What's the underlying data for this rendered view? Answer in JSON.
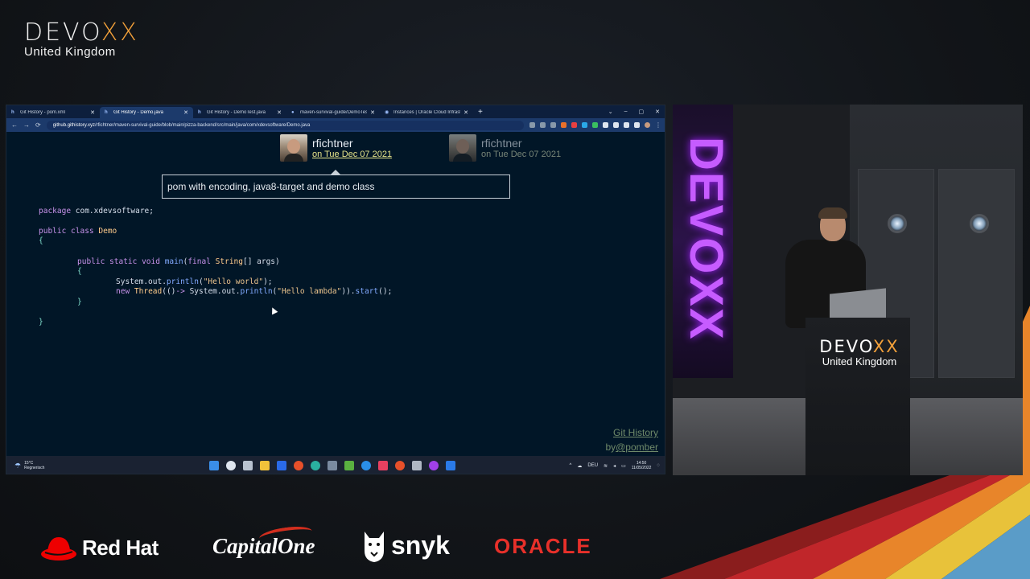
{
  "event_logo": {
    "word_prefix": "DEVO",
    "word_xx": "XX",
    "subtitle": "United Kingdom"
  },
  "browser": {
    "tabs": [
      {
        "favicon": "h",
        "title": "Git History - pom.xml",
        "active": false
      },
      {
        "favicon": "h",
        "title": "Git History - Demo.java",
        "active": true
      },
      {
        "favicon": "h",
        "title": "Git History - DemoTest.java",
        "active": false
      },
      {
        "favicon": "●",
        "title": "maven-survival-guide/DemoTes",
        "active": false
      },
      {
        "favicon": "◉",
        "title": "Instances | Oracle Cloud Infrastr",
        "active": false
      }
    ],
    "new_tab": "+",
    "window_controls": {
      "dropdown": "⌄",
      "minimize": "–",
      "maximize": "▢",
      "close": "✕"
    },
    "address": {
      "host": "github.githistory.xyz",
      "path": "/rfichtner/maven-survival-guide/blob/main/pizza-backend/src/main/java/com/xdevsoftware/Demo.java"
    },
    "nav": {
      "back": "←",
      "forward": "→",
      "reload": "⟳",
      "lock": "🔒"
    }
  },
  "git_history": {
    "commits": [
      {
        "author": "rfichtner",
        "date": "on Tue Dec 07 2021",
        "active": true
      },
      {
        "author": "rfichtner",
        "date": "on Tue Dec 07 2021",
        "active": false
      }
    ],
    "message": "pom with encoding, java8-target and demo class",
    "credit": {
      "title": "Git History",
      "by": "by",
      "handle": "@pomber"
    }
  },
  "code": {
    "l1": [
      "package",
      " com.xdevsoftware;"
    ],
    "l2": [
      "public class",
      " ",
      "Demo"
    ],
    "l3": "{",
    "l4": [
      "public static void",
      " ",
      "main",
      "(",
      "final",
      " ",
      "String",
      "[] args)"
    ],
    "l5": "{",
    "l6": [
      "System.out.",
      "println",
      "(",
      "\"Hello world\"",
      ");"
    ],
    "l7": [
      "new",
      " ",
      "Thread",
      "(()",
      "->",
      " System.out.",
      "println",
      "(",
      "\"Hello lambda\"",
      ")).",
      "start",
      "();"
    ],
    "l8": "}",
    "l9": "}"
  },
  "taskbar": {
    "weather": {
      "icon": "☂",
      "temp": "15°C",
      "condition": "Regnerisch"
    },
    "tray": {
      "chevron": "^",
      "lang": "DEU",
      "time": "14:50",
      "date": "11/05/2022"
    }
  },
  "stage": {
    "banner_word": "DEVOXX",
    "banner_sub": "United Kingdom",
    "podium_word_prefix": "DEVO",
    "podium_word_xx": "XX",
    "podium_sub": "United Kingdom"
  },
  "sponsors": {
    "redhat": "Red Hat",
    "capitalone": "CapitalOne",
    "snyk": "snyk",
    "oracle": "ORACLE"
  },
  "colors": {
    "accent_orange": "#f2a03a",
    "oracle_red": "#e8302a",
    "editor_bg": "#011627"
  }
}
